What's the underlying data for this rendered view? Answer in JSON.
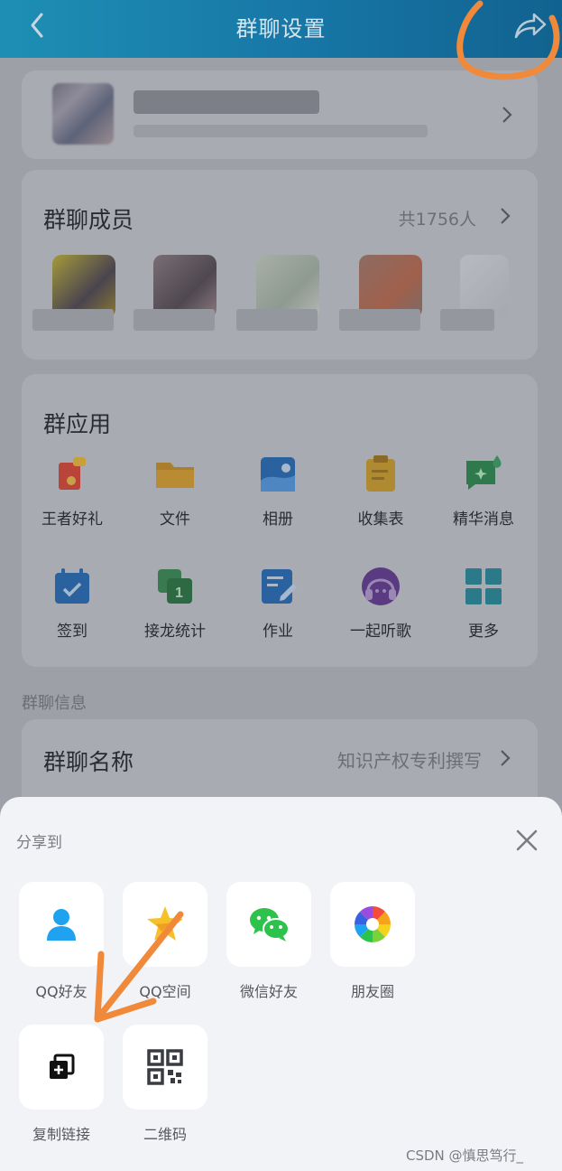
{
  "header": {
    "title": "群聊设置"
  },
  "members": {
    "title": "群聊成员",
    "count": "共1756人"
  },
  "apps": {
    "title": "群应用",
    "items": [
      {
        "label": "王者好礼",
        "icon": "gift-card-icon"
      },
      {
        "label": "文件",
        "icon": "folder-icon"
      },
      {
        "label": "相册",
        "icon": "photo-album-icon"
      },
      {
        "label": "收集表",
        "icon": "clipboard-icon"
      },
      {
        "label": "精华消息",
        "icon": "essence-message-icon"
      },
      {
        "label": "签到",
        "icon": "calendar-check-icon"
      },
      {
        "label": "接龙统计",
        "icon": "relay-stat-icon"
      },
      {
        "label": "作业",
        "icon": "homework-icon"
      },
      {
        "label": "一起听歌",
        "icon": "headphones-icon"
      },
      {
        "label": "更多",
        "icon": "grid-more-icon"
      }
    ]
  },
  "info": {
    "section_label": "群聊信息",
    "name_label": "群聊名称",
    "name_value": "知识产权专利撰写"
  },
  "share_sheet": {
    "title": "分享到",
    "items": [
      {
        "label": "QQ好友",
        "icon": "qq-friend-icon"
      },
      {
        "label": "QQ空间",
        "icon": "qzone-star-icon"
      },
      {
        "label": "微信好友",
        "icon": "wechat-icon"
      },
      {
        "label": "朋友圈",
        "icon": "moments-icon"
      },
      {
        "label": "复制链接",
        "icon": "copy-link-icon"
      },
      {
        "label": "二维码",
        "icon": "qr-code-icon"
      }
    ]
  },
  "watermark": "CSDN @慎思笃行_",
  "colors": {
    "header": "#1776a6",
    "annotation": "#f08a3a",
    "sheet_bg": "#f2f3f7"
  }
}
